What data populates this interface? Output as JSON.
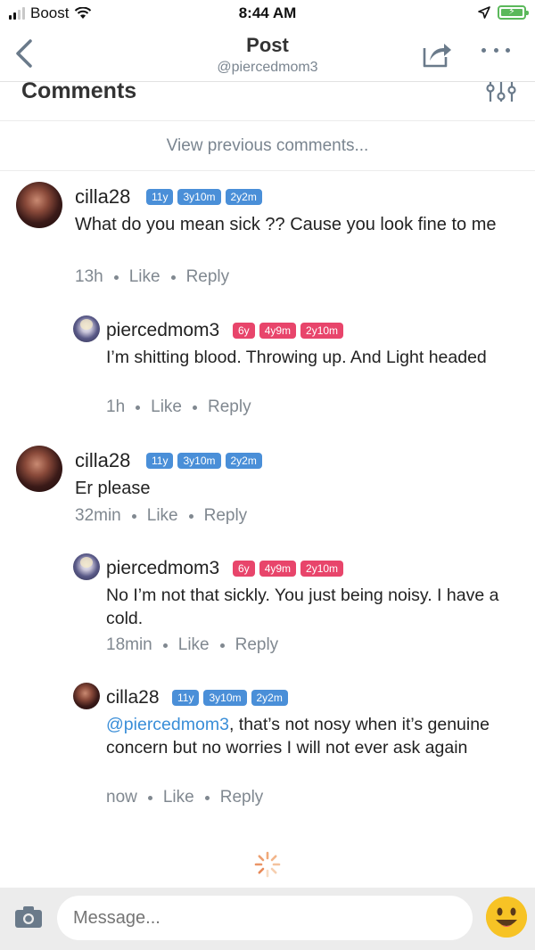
{
  "status_bar": {
    "carrier": "Boost",
    "time": "8:44 AM",
    "battery_icon": "battery-charging-icon"
  },
  "nav": {
    "title": "Post",
    "subtitle": "@piercedmom3",
    "back_icon": "chevron-left-icon",
    "share_icon": "share-icon",
    "more_icon": "more-dots-icon"
  },
  "comments_header": {
    "title": "Comments",
    "filter_icon": "filter-sliders-icon"
  },
  "view_previous": "View previous comments...",
  "comments": [
    {
      "user": "cilla28",
      "badges": [
        "11y",
        "3y10m",
        "2y2m"
      ],
      "text": "What do you mean sick ?? Cause you look fine to me",
      "time": "13h",
      "like": "Like",
      "reply": "Reply"
    },
    {
      "user": "piercedmom3",
      "badges": [
        "6y",
        "4y9m",
        "2y10m"
      ],
      "text": "I’m shitting blood. Throwing up. And Light headed",
      "time": "1h",
      "like": "Like",
      "reply": "Reply"
    },
    {
      "user": "cilla28",
      "badges": [
        "11y",
        "3y10m",
        "2y2m"
      ],
      "text": "Er please",
      "time": "32min",
      "like": "Like",
      "reply": "Reply"
    },
    {
      "user": "piercedmom3",
      "badges": [
        "6y",
        "4y9m",
        "2y10m"
      ],
      "text": "No I’m not that sickly. You just being noisy. I have a cold.",
      "time": "18min",
      "like": "Like",
      "reply": "Reply"
    },
    {
      "user": "cilla28",
      "badges": [
        "11y",
        "3y10m",
        "2y2m"
      ],
      "mention": "@piercedmom3",
      "text": ", that’s not nosy when it’s genuine concern but no worries I will not ever ask again",
      "time": "now",
      "like": "Like",
      "reply": "Reply"
    }
  ],
  "composer": {
    "placeholder": "Message...",
    "camera_icon": "camera-icon",
    "emoji_icon": "smiley-emoji-icon"
  },
  "colors": {
    "badge_blue": "#4a8fd8",
    "badge_pink": "#e8456b",
    "mention": "#3a8ed8"
  }
}
